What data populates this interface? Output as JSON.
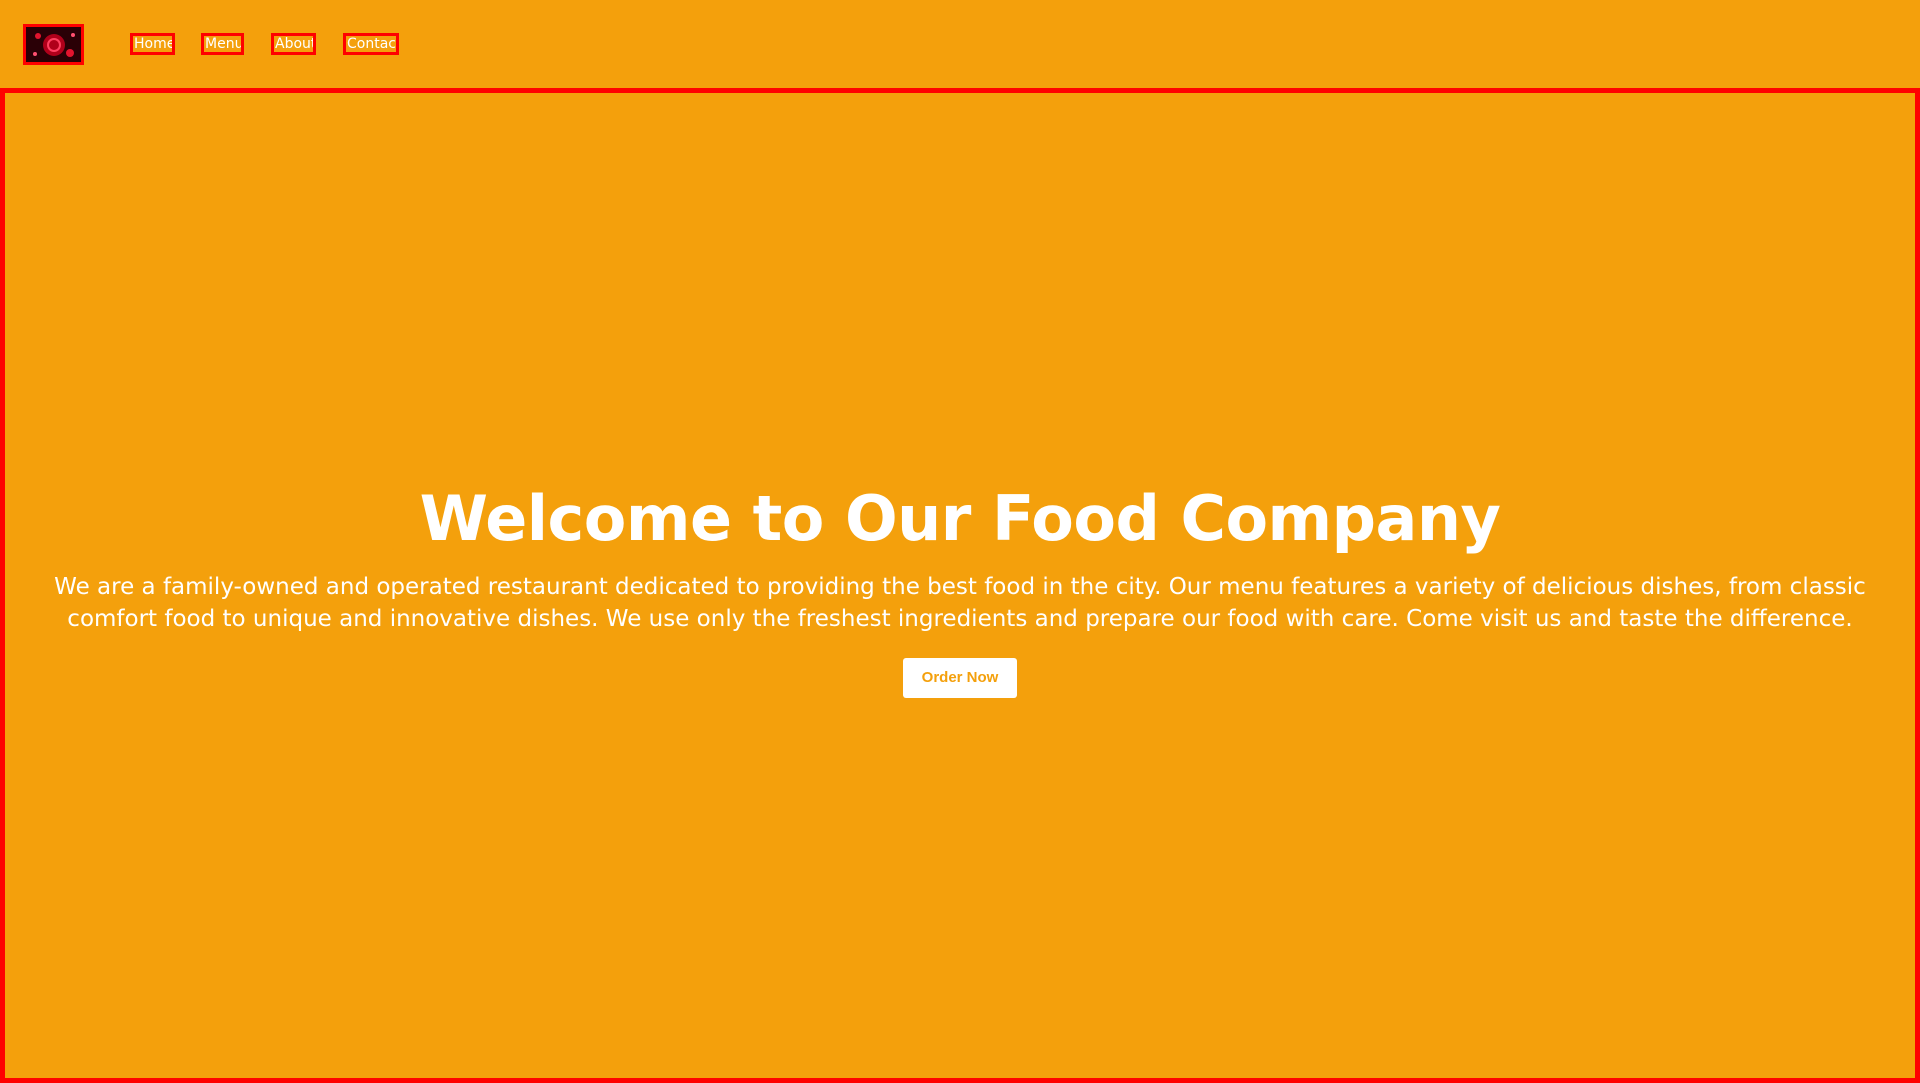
{
  "header": {
    "logo_icon": "food-photo-logo-icon",
    "nav": [
      {
        "label": "Home"
      },
      {
        "label": "Menu"
      },
      {
        "label": "About"
      },
      {
        "label": "Contact"
      }
    ]
  },
  "hero": {
    "title": "Welcome to Our Food Company",
    "description": "We are a family-owned and operated restaurant dedicated to providing the best food in the city. Our menu features a variety of delicious dishes, from classic comfort food to unique and innovative dishes. We use only the freshest ingredients and prepare our food with care. Come visit us and taste the difference.",
    "cta_label": "Order Now"
  },
  "colors": {
    "background": "#f4a00c",
    "outline": "#ff0000",
    "text": "#ffffff",
    "button_bg": "#ffffff",
    "button_text": "#f4a00c"
  }
}
